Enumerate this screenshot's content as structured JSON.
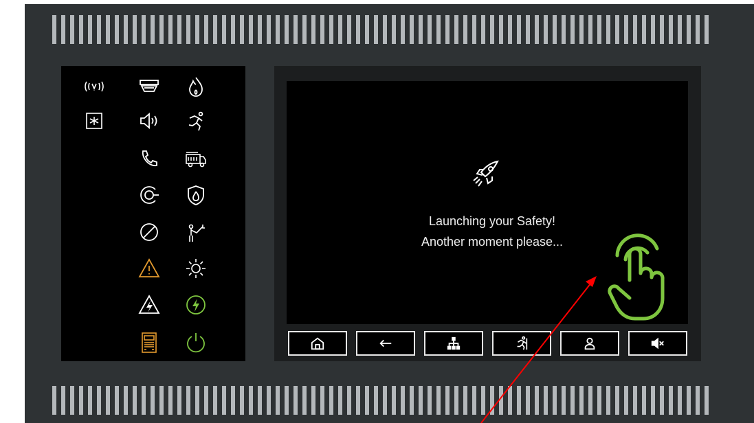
{
  "display": {
    "line1": "Launching your Safety!",
    "line2": "Another moment please..."
  },
  "led_icons": [
    "alarm-signal-icon",
    "smoke-detector-icon",
    "fire-icon",
    "fault-box-icon",
    "sounder-icon",
    "evacuation-run-icon",
    "telephone-icon",
    "fire-truck-icon",
    "disabled-circle-icon",
    "fire-protection-icon",
    "prohibited-icon",
    "fire-fighter-hose-icon",
    "warning-triangle-icon",
    "sun-test-icon",
    "power-fault-icon",
    "power-green-icon",
    "battery-panel-icon",
    "power-on-icon"
  ],
  "softkeys": [
    "home-icon",
    "back-arrow-icon",
    "menu-tree-icon",
    "evacuation-icon",
    "user-icon",
    "mute-icon"
  ],
  "colors": {
    "warning": "#e39a2e",
    "ok": "#7ec53f",
    "touch": "#7ec53f",
    "arrow": "#ff0000"
  }
}
